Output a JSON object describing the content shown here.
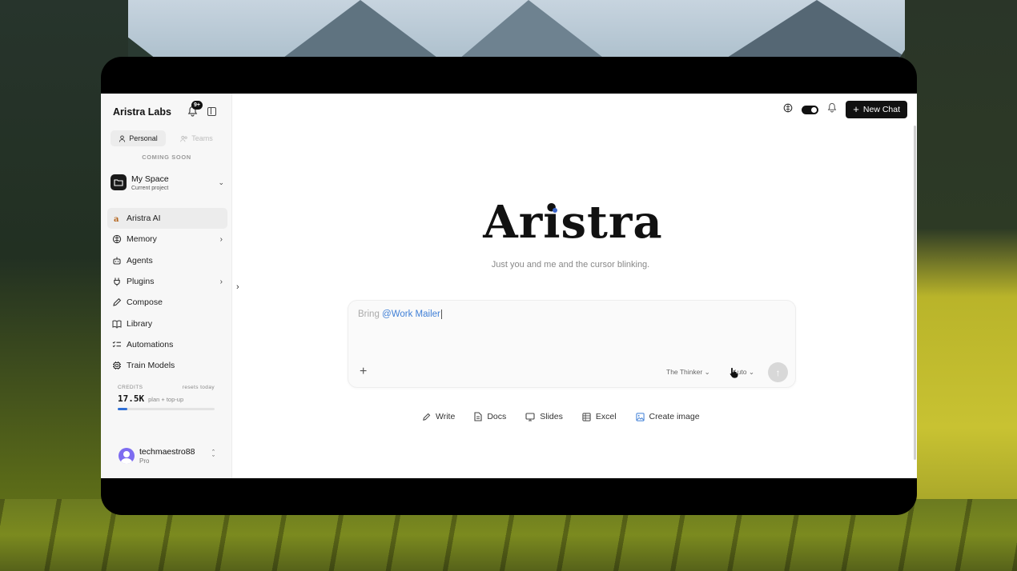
{
  "sidebar": {
    "brand": "Aristra Labs",
    "notification_badge": "9+",
    "tabs": [
      {
        "label": "Personal",
        "active": true
      },
      {
        "label": "Teams",
        "active": false
      }
    ],
    "coming_soon": "COMING SOON",
    "space": {
      "title": "My Space",
      "subtitle": "Current project"
    },
    "nav": [
      {
        "label": "Aristra AI",
        "icon": "aristra-logo-icon",
        "active": true
      },
      {
        "label": "Memory",
        "icon": "brain-icon",
        "has_submenu": true
      },
      {
        "label": "Agents",
        "icon": "robot-icon"
      },
      {
        "label": "Plugins",
        "icon": "plug-icon",
        "has_submenu": true
      },
      {
        "label": "Compose",
        "icon": "pencil-icon"
      },
      {
        "label": "Library",
        "icon": "book-icon"
      },
      {
        "label": "Automations",
        "icon": "checklist-icon"
      },
      {
        "label": "Train Models",
        "icon": "chip-icon"
      }
    ],
    "credits": {
      "label": "CREDITS",
      "reset": "resets today",
      "value": "17.5K",
      "plan": "plan + top-up",
      "progress": 0.1
    },
    "user": {
      "name": "techmaestro88",
      "plan": "Pro"
    }
  },
  "topbar": {
    "new_chat_label": "New Chat"
  },
  "main": {
    "logo": "Aristra",
    "tagline": "Just you and me and the cursor blinking.",
    "composer": {
      "prefix": "Bring ",
      "mention": "@Work Mailer",
      "model": "The Thinker",
      "mode": "Auto"
    },
    "quick_actions": [
      {
        "label": "Write",
        "icon": "pencil-icon"
      },
      {
        "label": "Docs",
        "icon": "document-icon"
      },
      {
        "label": "Slides",
        "icon": "monitor-icon"
      },
      {
        "label": "Excel",
        "icon": "table-icon"
      },
      {
        "label": "Create image",
        "icon": "image-icon"
      }
    ]
  },
  "colors": {
    "accent": "#3f7fd6",
    "dark": "#111111",
    "sidebar_bg": "#f7f7f7"
  }
}
